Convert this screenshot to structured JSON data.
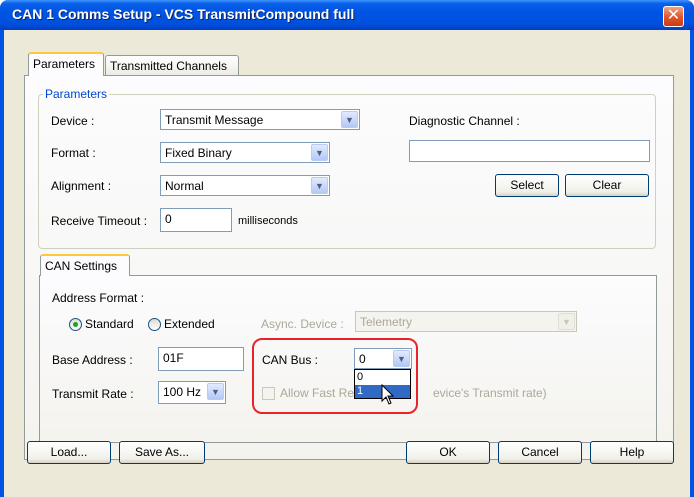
{
  "window": {
    "title": "CAN 1 Comms Setup - VCS TransmitCompound full",
    "close_glyph": "✕"
  },
  "tabs": [
    {
      "label": "Parameters",
      "active": true
    },
    {
      "label": "Transmitted Channels",
      "active": false
    }
  ],
  "parameters_group": {
    "title": "Parameters",
    "device": {
      "label": "Device :",
      "value": "Transmit Message"
    },
    "format": {
      "label": "Format :",
      "value": "Fixed Binary"
    },
    "alignment": {
      "label": "Alignment :",
      "value": "Normal"
    },
    "receive_timeout": {
      "label": "Receive Timeout :",
      "value": "0",
      "unit": "milliseconds"
    },
    "diagnostic_channel": {
      "label": "Diagnostic Channel :",
      "value": ""
    },
    "select_label": "Select",
    "clear_label": "Clear"
  },
  "can_settings": {
    "tab_label": "CAN Settings",
    "address_format_label": "Address Format :",
    "standard_label": "Standard",
    "extended_label": "Extended",
    "address_format_selected": "Standard",
    "async_device": {
      "label": "Async. Device :",
      "value": "Telemetry",
      "enabled": false
    },
    "base_address": {
      "label": "Base Address :",
      "value": "01F"
    },
    "can_bus": {
      "label": "CAN Bus :",
      "value": "0",
      "options": [
        "0",
        "1"
      ],
      "highlighted_option": "1"
    },
    "transmit_rate": {
      "label": "Transmit Rate :",
      "value": "100 Hz"
    },
    "allow_fast": {
      "label_left": "Allow Fast Re",
      "label_right": "evice's Transmit rate)",
      "checked": false,
      "enabled": false
    }
  },
  "footer": {
    "load_label": "Load...",
    "save_as_label": "Save As...",
    "ok_label": "OK",
    "cancel_label": "Cancel",
    "help_label": "Help"
  },
  "colors": {
    "title_bar": "#0054e3",
    "dialog_bg": "#ece9d8",
    "highlight_ring": "#e8242b",
    "selected_option": "#316ac5"
  },
  "icons": {
    "dropdown_arrow": "chevron-down-icon",
    "close": "close-icon",
    "cursor": "mouse-pointer-icon"
  }
}
